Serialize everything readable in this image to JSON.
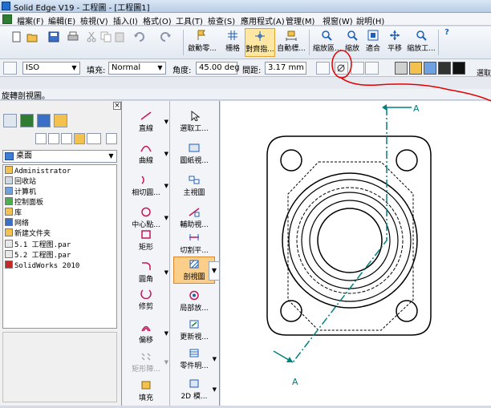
{
  "window": {
    "title": "Solid Edge V19 - 工程圖 - [工程圖1]"
  },
  "menu": [
    "檔案(F)",
    "編輯(E)",
    "檢視(V)",
    "插入(I)",
    "格式(O)",
    "工具(T)",
    "檢查(S)",
    "應用程式(A)",
    "管理(M)",
    "視窗(W)",
    "說明(H)"
  ],
  "toolbar": {
    "small_icons": [
      "new-icon",
      "open-icon",
      "save-icon",
      "print-icon",
      "cut-icon",
      "copy-icon",
      "paste-icon",
      "undo-icon",
      "redo-icon"
    ],
    "big_buttons": [
      "啟動零...",
      "柵格",
      "對齊指...",
      "自動標...",
      "縮放區...",
      "縮放",
      "適合",
      "平移",
      "縮放工...",
      "?"
    ]
  },
  "format_bar": {
    "style_value": "ISO",
    "fill_label": "填充:",
    "fill_value": "Normal",
    "angle_label": "角度:",
    "angle_value": "45.00 deg",
    "spacing_label": "間距:",
    "spacing_value": "3.17 mm",
    "cut_label": "選取"
  },
  "status": {
    "text": "旋轉剖視圖。"
  },
  "left_panel": {
    "location": "桌面",
    "files": [
      {
        "name": "Administrator",
        "icon": "user-folder-icon"
      },
      {
        "name": "回收站",
        "icon": "recycle-bin-icon"
      },
      {
        "name": "计算机",
        "icon": "computer-icon"
      },
      {
        "name": "控制面板",
        "icon": "control-panel-icon"
      },
      {
        "name": "库",
        "icon": "library-icon"
      },
      {
        "name": "网络",
        "icon": "network-icon"
      },
      {
        "name": "新建文件夹",
        "icon": "folder-icon"
      },
      {
        "name": "5.1 工程图.par",
        "icon": "part-file-icon"
      },
      {
        "name": "5.2 工程图.par",
        "icon": "part-file-icon"
      },
      {
        "name": "SolidWorks 2010",
        "icon": "solidworks-icon"
      }
    ]
  },
  "draw_tools": [
    "直線",
    "曲線",
    "相切圓...",
    "中心點...",
    "矩形",
    "圓角",
    "修剪",
    "偏移",
    "矩形陣...",
    "填充"
  ],
  "view_tools": [
    "選取工...",
    "圖紙視...",
    "主視圖",
    "輔助視...",
    "切割平...",
    "剖視圖",
    "局部放...",
    "更新視...",
    "零件明...",
    "2D 模..."
  ],
  "drawing": {
    "section_label_top": "A",
    "section_label_bottom": "A",
    "line_color": "#008080",
    "annotation_color": "#e00000"
  }
}
